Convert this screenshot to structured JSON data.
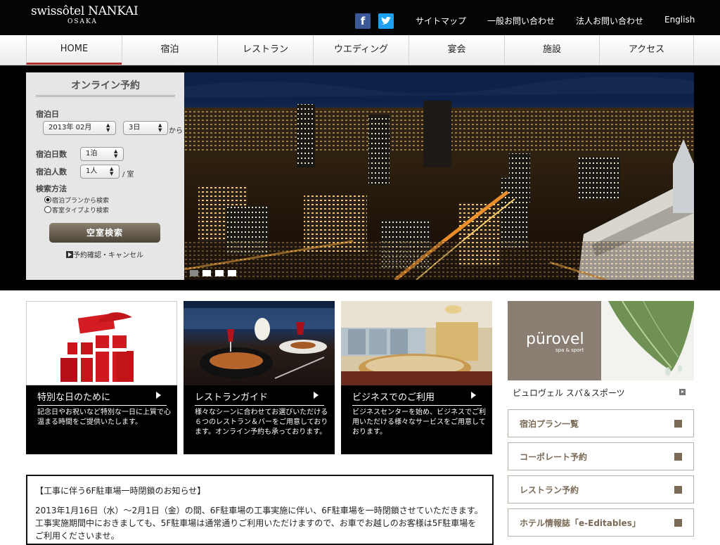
{
  "header": {
    "logo_line1": "swissôtel NANKAI",
    "logo_line2": "OSAKA",
    "facebook_glyph": "f",
    "twitter_glyph": "t",
    "links": [
      "サイトマップ",
      "一般お問い合わせ",
      "法人お問い合わせ",
      "English"
    ]
  },
  "nav": {
    "items": [
      "HOME",
      "宿泊",
      "レストラン",
      "ウエディング",
      "宴会",
      "施設",
      "アクセス"
    ],
    "active_index": 0
  },
  "booking": {
    "title": "オンライン予約",
    "date_label": "宿泊日",
    "month_value": "2013年 02月",
    "day_value": "3日",
    "from_label": "から",
    "nights_label": "宿泊日数",
    "nights_value": "1泊",
    "guests_label": "宿泊人数",
    "guests_value": "1人",
    "per_room": "/ 室",
    "method_label": "検索方法",
    "option_plan": "宿泊プランから検索",
    "option_room": "客室タイプより検索",
    "search_button": "空室検索",
    "confirm_link": "予約確認・キャンセル"
  },
  "hero": {
    "slide_count": 4,
    "current_slide": 1
  },
  "cards": [
    {
      "title": "特別な日のために",
      "desc": "記念日やお祝いなど特別な一日に上質で心温まる時間をご提供いたします。"
    },
    {
      "title": "レストランガイド",
      "desc": "様々なシーンに合わせてお選びいただける６つのレストラン＆バーをご用意しております。オンライン予約も承っております。"
    },
    {
      "title": "ビジネスでのご利用",
      "desc": "ビジネスセンターを始め、ビジネスでご利用いただける様々なサービスをご用意しております。"
    }
  ],
  "sidebar": {
    "purovel_logo": "pürovel",
    "purovel_tag": "spa & sport",
    "purovel_caption": "ピュロヴェル スパ＆スポーツ",
    "buttons": [
      "宿泊プラン一覧",
      "コーポレート予約",
      "レストラン予約",
      "ホテル情報誌「e-Editables」"
    ]
  },
  "notice": {
    "title": "【工事に伴う6F駐車場一時閉鎖のお知らせ】",
    "body": "2013年1月16日（水）～2月1日（金）の間、6F駐車場の工事実施に伴い、6F駐車場を一時閉鎖させていただきます。",
    "body2": "工事実施期間中におきましても、5F駐車場は通常通りご利用いただけますので、お車でお越しのお客様は5F駐車場をご利用くださいませ。"
  },
  "colors": {
    "topbar": "#050505",
    "nav_active_underline": "#b23432",
    "side_button_text": "#7a6a56",
    "purovel_bg": "#8a7e73"
  }
}
